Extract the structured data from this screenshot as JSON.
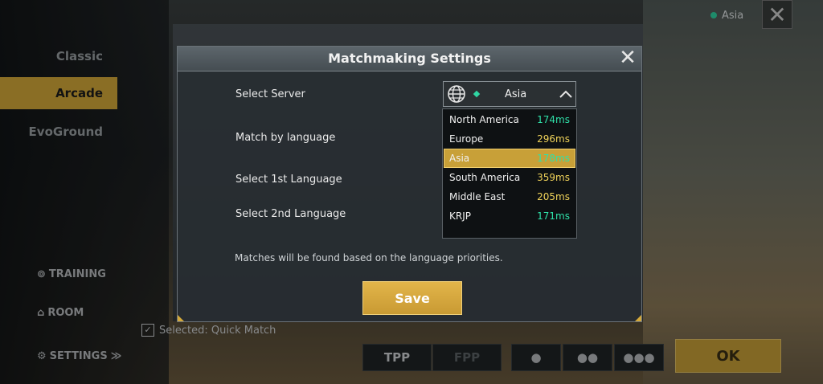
{
  "background": {
    "tabs": [
      "Classic",
      "Arcade",
      "EvoGround"
    ],
    "side_items": {
      "training": "TRAINING",
      "room": "ROOM",
      "settings": "SETTINGS"
    },
    "top_server": "Asia",
    "selected_label": "Selected: Quick Match",
    "bottom": {
      "tpp": "TPP",
      "fpp": "FPP",
      "ok": "OK"
    }
  },
  "dialog": {
    "title": "Matchmaking Settings",
    "labels": {
      "select_server": "Select Server",
      "match_by_language": "Match by language",
      "first_language": "Select 1st Language",
      "second_language": "Select 2nd Language"
    },
    "note": "Matches will be found based on the language priorities.",
    "save_label": "Save",
    "server": {
      "selected": "Asia",
      "options": [
        {
          "name": "North America",
          "ping": "174ms",
          "color": "#2fe0a8"
        },
        {
          "name": "Europe",
          "ping": "296ms",
          "color": "#f0d35a"
        },
        {
          "name": "Asia",
          "ping": "178ms",
          "color": "#2fe0a8"
        },
        {
          "name": "South America",
          "ping": "359ms",
          "color": "#f0d35a"
        },
        {
          "name": "Middle East",
          "ping": "205ms",
          "color": "#f0d35a"
        },
        {
          "name": "KRJP",
          "ping": "171ms",
          "color": "#2fe0a8"
        }
      ]
    }
  },
  "colors": {
    "accent": "#d4a93a",
    "good_ping": "#2fe0a8",
    "mid_ping": "#f0d35a"
  }
}
